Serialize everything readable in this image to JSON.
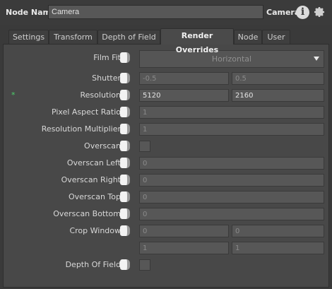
{
  "header": {
    "label": "Node Name",
    "value": "Camera",
    "type": "Camera"
  },
  "tabs": [
    {
      "label": "Settings"
    },
    {
      "label": "Transform"
    },
    {
      "label": "Depth of Field"
    },
    {
      "label": "Render Overrides",
      "active": true
    },
    {
      "label": "Node"
    },
    {
      "label": "User"
    }
  ],
  "params": {
    "film_fit": {
      "label": "Film Fit",
      "value": "Horizontal"
    },
    "shutter": {
      "label": "Shutter",
      "v1": "-0.5",
      "v2": "0.5"
    },
    "resolution": {
      "label": "Resolution",
      "marker": "*",
      "v1": "5120",
      "v2": "2160"
    },
    "pixel_aspect": {
      "label": "Pixel Aspect Ratio",
      "v1": "1"
    },
    "res_mult": {
      "label": "Resolution Multiplier",
      "v1": "1"
    },
    "overscan": {
      "label": "Overscan"
    },
    "overscan_left": {
      "label": "Overscan Left",
      "v1": "0"
    },
    "overscan_right": {
      "label": "Overscan Right",
      "v1": "0"
    },
    "overscan_top": {
      "label": "Overscan Top",
      "v1": "0"
    },
    "overscan_bottom": {
      "label": "Overscan Bottom",
      "v1": "0"
    },
    "crop_window": {
      "label": "Crop Window",
      "v1": "0",
      "v2": "0",
      "v3": "1",
      "v4": "1"
    },
    "dof": {
      "label": "Depth Of Field"
    }
  },
  "colors": {
    "background": "#3a3a3a",
    "panel": "#484848",
    "field": "#575757",
    "accent_star": "#4bd06a"
  }
}
